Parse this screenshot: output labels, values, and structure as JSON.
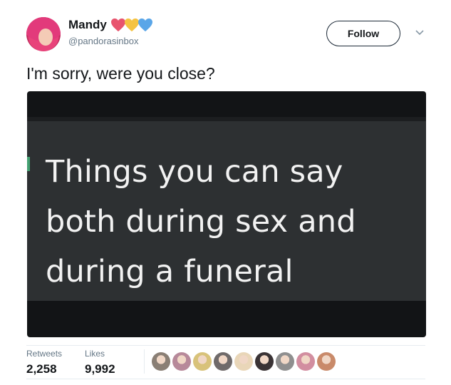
{
  "tweet": {
    "author_name": "Mandy",
    "author_handle": "@pandorasinbox",
    "follow_label": "Follow",
    "text": "I'm sorry, were you close?",
    "media_text_lines": [
      "Things you can say",
      "both during sex and",
      "during a funeral"
    ]
  },
  "stats": {
    "retweets_label": "Retweets",
    "retweets_value": "2,258",
    "likes_label": "Likes",
    "likes_value": "9,992"
  },
  "colors": {
    "heart_pink": "#e8546e",
    "heart_yellow": "#f5c342",
    "heart_blue": "#5aa6e8",
    "follow_border": "#1b2836",
    "meme_panel": "#2d3032",
    "meme_accent": "#43a071"
  },
  "likers": [
    {
      "icon": "avatar-photo",
      "color": "#8a7f75"
    },
    {
      "icon": "avatar-photo",
      "color": "#b7899a"
    },
    {
      "icon": "avatar-photo",
      "color": "#d8c27a"
    },
    {
      "icon": "avatar-photo",
      "color": "#6f6a6a"
    },
    {
      "icon": "avatar-photo",
      "color": "#e9d6b8"
    },
    {
      "icon": "avatar-photo",
      "color": "#3a3335"
    },
    {
      "icon": "avatar-photo",
      "color": "#8f8f8f"
    },
    {
      "icon": "avatar-photo",
      "color": "#d28ea0"
    },
    {
      "icon": "avatar-photo",
      "color": "#c98a6a"
    }
  ]
}
